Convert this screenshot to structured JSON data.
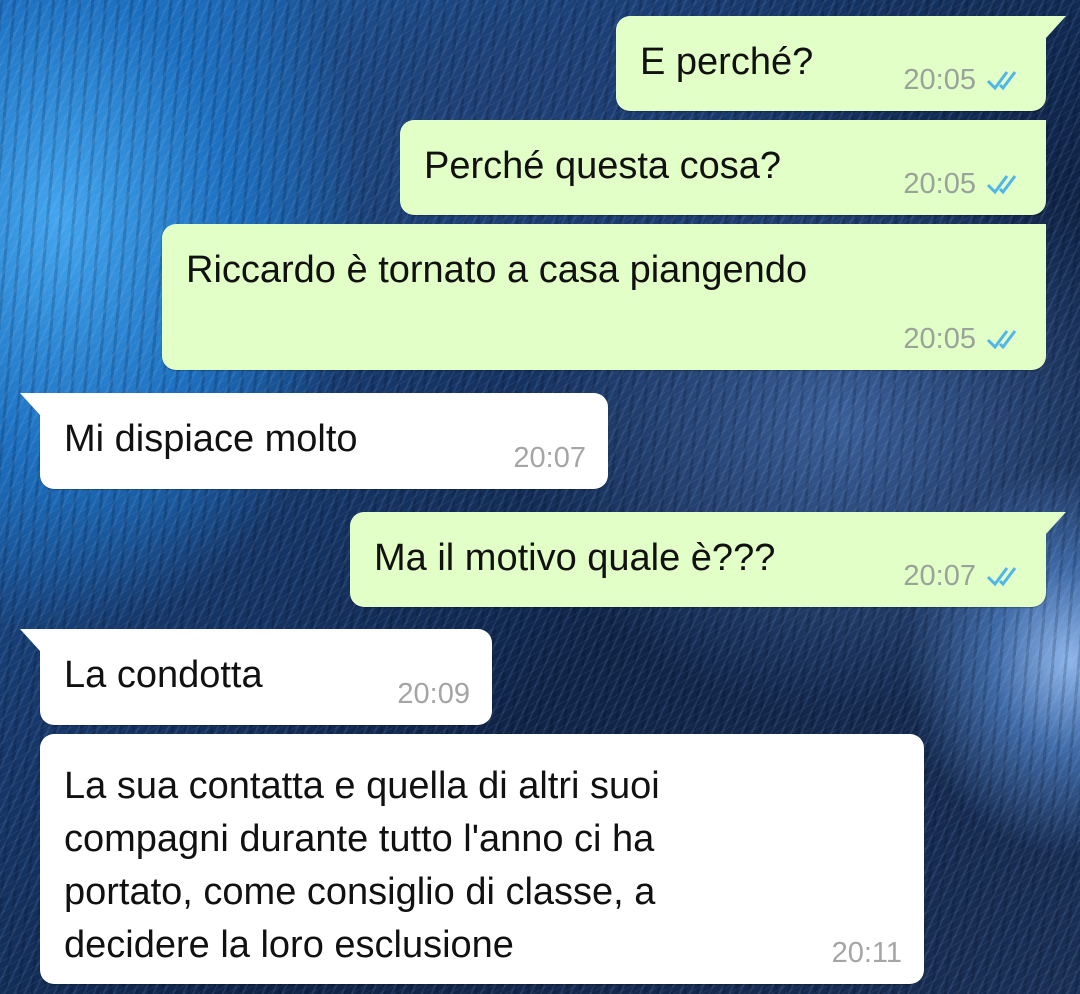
{
  "colors": {
    "outgoing_bubble": "#e1ffc7",
    "incoming_bubble": "#ffffff",
    "read_ticks": "#4fb6ec"
  },
  "messages": [
    {
      "direction": "outgoing",
      "text": "E perché?",
      "time": "20:05",
      "status": "read",
      "status_icon": "double-check-icon"
    },
    {
      "direction": "outgoing",
      "text": "Perché questa cosa?",
      "time": "20:05",
      "status": "read",
      "status_icon": "double-check-icon"
    },
    {
      "direction": "outgoing",
      "text": "Riccardo è tornato a casa piangendo",
      "time": "20:05",
      "status": "read",
      "status_icon": "double-check-icon"
    },
    {
      "direction": "incoming",
      "text": "Mi dispiace molto",
      "time": "20:07"
    },
    {
      "direction": "outgoing",
      "text": "Ma il motivo quale è???",
      "time": "20:07",
      "status": "read",
      "status_icon": "double-check-icon"
    },
    {
      "direction": "incoming",
      "text": "La condotta",
      "time": "20:09"
    },
    {
      "direction": "incoming",
      "text": "La sua contatta e quella di altri suoi\ncompagni durante tutto l'anno ci ha\nportato, come consiglio di classe, a\ndecidere la loro esclusione",
      "time": "20:11"
    }
  ]
}
